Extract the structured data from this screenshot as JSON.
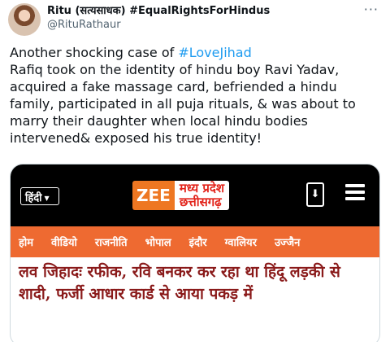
{
  "author": {
    "name": "Ritu (सत्यसाधक) #EqualRightsForHindus",
    "handle": "@RituRathaur"
  },
  "tweet": {
    "text_before": "Another shocking case of ",
    "hashtag": "#LoveJihad",
    "text_after": "Rafiq took on the identity of hindu boy Ravi Yadav, acquired a fake massage card, befriended a hindu family, participated in all puja rituals, & was about to marry their daughter when local hindu bodies intervened& exposed his true identity!"
  },
  "card": {
    "language": "हिंदी",
    "logo_brand": "ZEE",
    "logo_line1": "मध्य प्रदेश",
    "logo_line2": "छत्तीसगढ़",
    "nav": [
      "होम",
      "वीडियो",
      "राजनीति",
      "भोपाल",
      "इंदौर",
      "ग्वालियर",
      "उज्जैन"
    ],
    "headline": "लव जिहादः रफीक, रवि बनकर कर रहा था हिंदू लड़की से शादी, फर्जी आधार कार्ड से आया पकड़ में"
  },
  "colors": {
    "hashtag": "#1d9bf0",
    "nav_bg": "#ee6a31",
    "zee_orange": "#ee7722",
    "headline": "#8a1a1a"
  }
}
